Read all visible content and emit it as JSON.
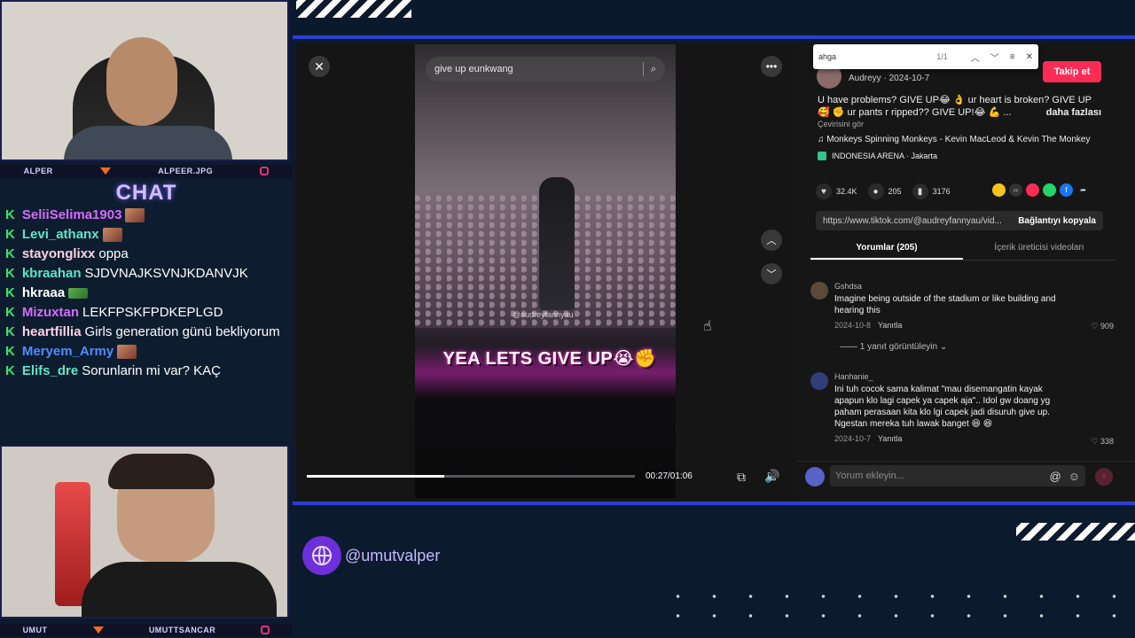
{
  "cams": {
    "top": {
      "left_label": "ALPER",
      "right_label": "ALPEER.JPG"
    },
    "bottom": {
      "left_label": "UMUT",
      "right_label": "UMUTTSANCAR"
    }
  },
  "chat": {
    "title": "CHAT",
    "messages": [
      {
        "user": "SeliiSelima1903",
        "text": "",
        "color": "#d86bff",
        "emote": true
      },
      {
        "user": "Levi_athanx",
        "text": "",
        "color": "#5ee5c7",
        "emote": true
      },
      {
        "user": "stayonglixx",
        "text": "oppa",
        "color": "#ffd2e6",
        "emote": false
      },
      {
        "user": "kbraahan",
        "text": "SJDVNAJKSVNJKDANVJK",
        "color": "#5ee5c7",
        "emote": false
      },
      {
        "user": "hkraaa",
        "text": "",
        "color": "#ffffff",
        "emote": true
      },
      {
        "user": "Mizuxtan",
        "text": "LEKFPSKFPDKEPLGD",
        "color": "#d86bff",
        "emote": false
      },
      {
        "user": "heartfillia",
        "text": "Girls generation günü bekliyorum",
        "color": "#ffd2e6",
        "emote": false
      },
      {
        "user": "Meryem_Army",
        "text": "",
        "color": "#4f8cff",
        "emote": true
      },
      {
        "user": "Elifs_dre",
        "text": "Sorunlarin mi var? KAÇ",
        "color": "#5ee5c7",
        "emote": false
      }
    ]
  },
  "player": {
    "search_placeholder": "give up eunkwang",
    "caption": "YEA LETS GIVE UP😭✊",
    "watermark": "@audreyfannyau",
    "time": "00:27/01:06",
    "progress_pct": 41.9
  },
  "findbar": {
    "query": "ahga",
    "count": "1/1"
  },
  "post": {
    "author_line": "Audreyy · 2024-10-7",
    "follow_label": "Takip et",
    "description": "U have problems? GIVE UP😂 👌 ur heart is broken? GIVE UP🥰 ✊ ur pants r ripped?? GIVE UP!😂 💪 ...",
    "more_label": "daha fazlası",
    "see_translation": "Çevirisini gör",
    "music": "♫  Monkeys Spinning Monkeys - Kevin MacLeod & Kevin The Monkey",
    "place": "INDONESIA ARENA · Jakarta",
    "likes": "32.4K",
    "comments": "205",
    "saves": "3176",
    "url": "https://www.tiktok.com/@audreyfannyau/vid...",
    "copy_label": "Bağlantıyı kopyala"
  },
  "tabs": {
    "comments": "Yorumlar (205)",
    "creator": "İçerik üreticisi videoları"
  },
  "comments": [
    {
      "name": "Gshdsa",
      "text": "Imagine being outside of the stadium or like building and hearing this",
      "date": "2024-10-8",
      "reply": "Yanıtla",
      "likes": "909"
    },
    {
      "name": "Hanhanie_",
      "text": "Ini tuh cocok sama kalimat \"mau disemangatin kayak apapun klo lagi capek ya capek aja\".. Idol gw doang yg paham perasaan kita klo lgi capek jadi disuruh give up. Ngestan mereka tuh lawak banget 😆 😆",
      "date": "2024-10-7",
      "reply": "Yanıtla",
      "likes": "338"
    }
  ],
  "view_replies": "—— 1 yanıt görüntüleyin ⌄",
  "comment_input": {
    "placeholder": "Yorum ekleyin..."
  },
  "brand": {
    "handle": "@umutvalper"
  }
}
